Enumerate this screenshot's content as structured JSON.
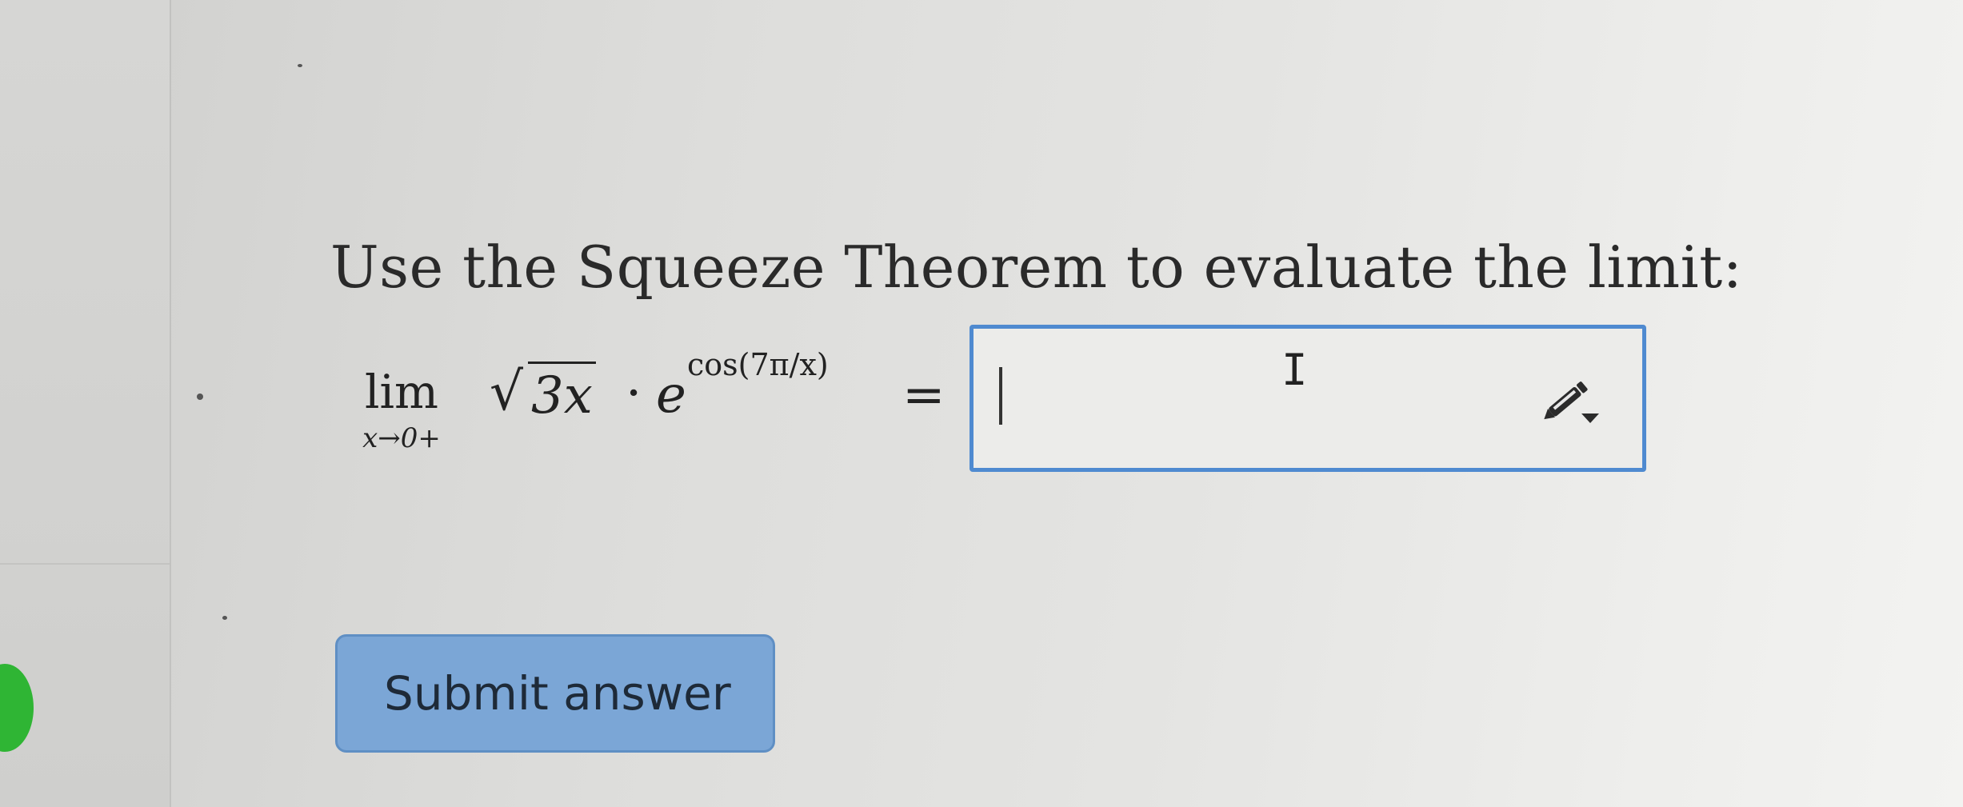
{
  "question": {
    "text": "Use the Squeeze Theorem to evaluate the limit:"
  },
  "formula": {
    "lim": "lim",
    "subscript": "x→0+",
    "radical_sign": "√",
    "radicand": "3x",
    "dot": "·",
    "base": "e",
    "exponent": "cos(7π/x)",
    "equals": "="
  },
  "answer_input": {
    "value": "",
    "cursor_glyph": "I",
    "tool_icon": "pencil-dropdown-icon"
  },
  "submit": {
    "label": "Submit answer"
  },
  "colors": {
    "accent_border": "#4f8ad0",
    "button_fill": "#7ba6d6",
    "status_green": "#2fb534"
  }
}
